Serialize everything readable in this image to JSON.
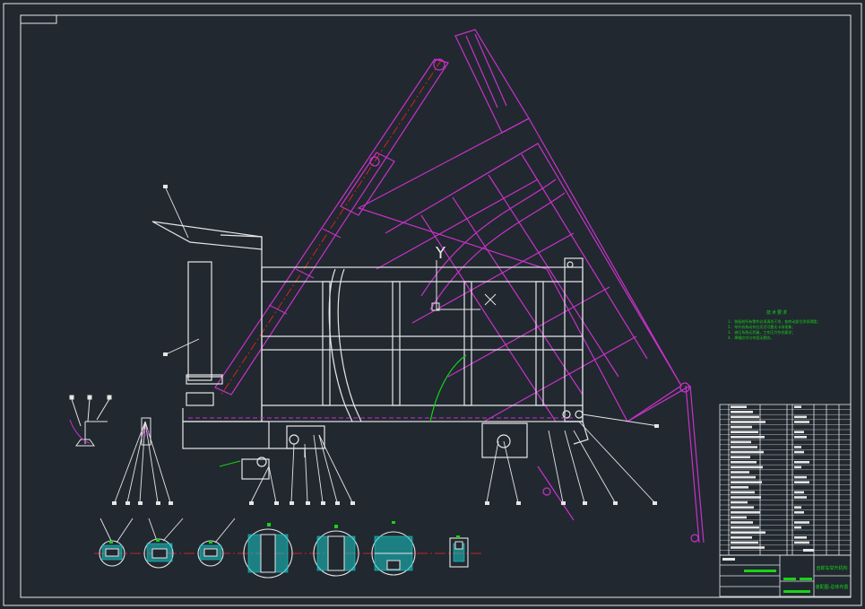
{
  "drawing": {
    "axis_y_label": "Y",
    "axis_x_label": "X"
  },
  "technical_notes": {
    "title": "技术要求",
    "lines": [
      "1. 装配前所有零件必须清洗干净，各转动部位涂润滑脂；",
      "2. 举升机构动作应灵活可靠无卡滞现象；",
      "3. 液压系统无泄漏，工作压力符合要求；",
      "4. 焊缝应均匀牢固无裂纹。"
    ]
  },
  "colors": {
    "background": "#212830",
    "outline": "#e6e6e6",
    "magenta": "#c832c8",
    "red_center": "#ff2020",
    "cyan_hatch": "#19c8c8",
    "green": "#19d219"
  },
  "title_block": {
    "title_line1": "自卸车举升机构",
    "title_line2": "装配图-总体布置"
  }
}
